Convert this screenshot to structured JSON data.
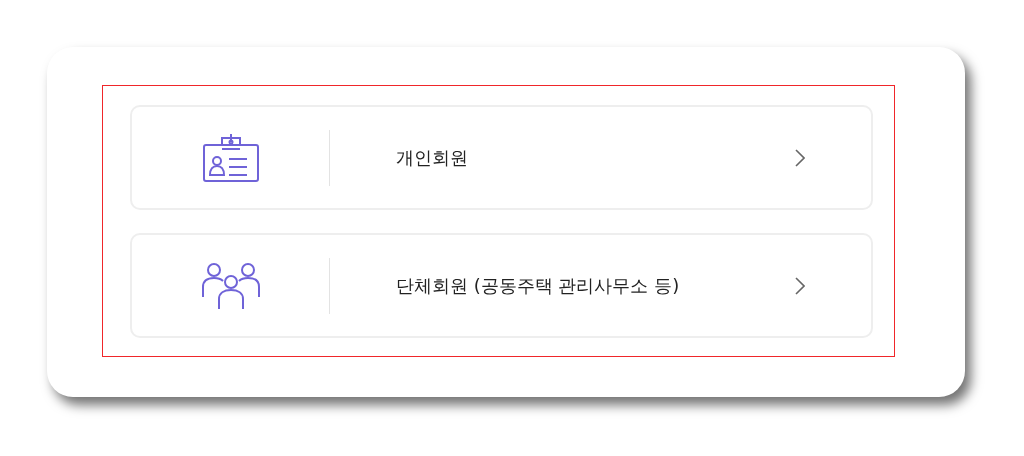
{
  "options": [
    {
      "kind": "individual",
      "label": "개인회원"
    },
    {
      "kind": "group",
      "label": "단체회원 (공동주택 관리사무소 등)"
    }
  ]
}
